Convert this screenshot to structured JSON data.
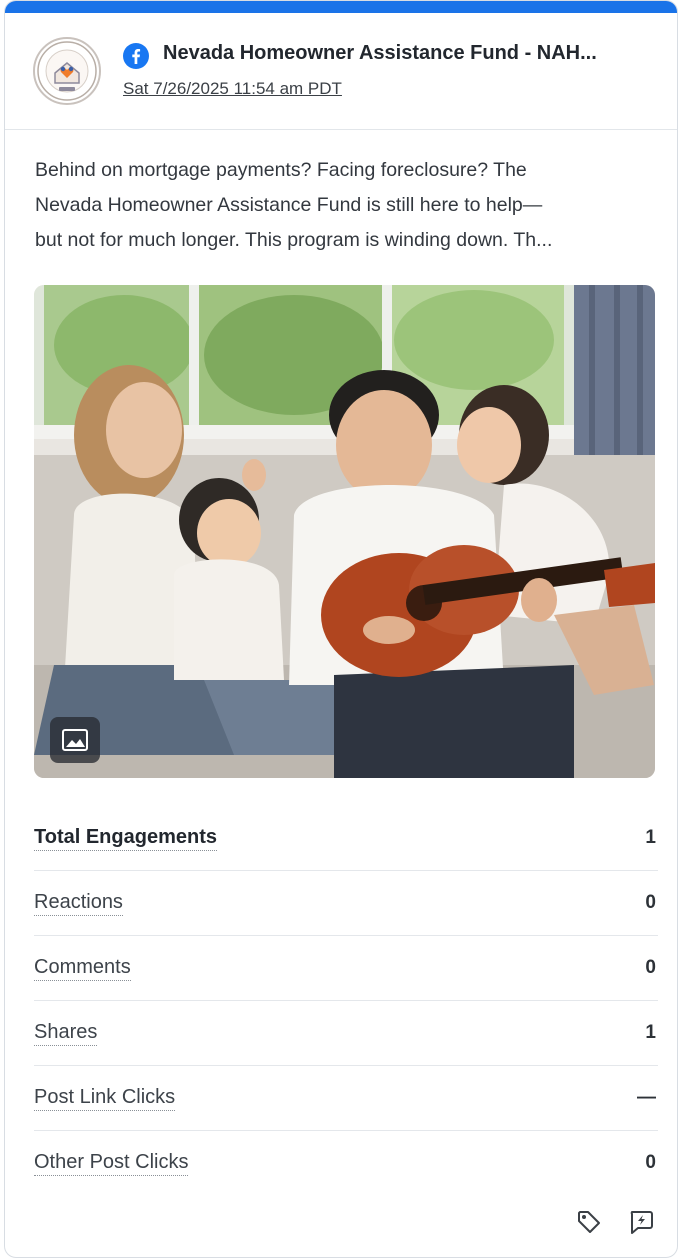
{
  "post": {
    "page_name": "Nevada Homeowner Assistance Fund - NAH...",
    "timestamp": "Sat 7/26/2025 11:54 am PDT",
    "network_icon": "facebook-icon",
    "avatar_logo_text": "HOMEOWNER ASSISTANCE FUND · NAHAC",
    "text_lines": [
      "Behind on mortgage payments? Facing foreclosure? The",
      "Nevada Homeowner Assistance Fund is still here to help—",
      "but not for much longer. This program is winding down. Th..."
    ],
    "media_badge_icon": "image-icon"
  },
  "metrics": [
    {
      "label": "Total Engagements",
      "value": "1"
    },
    {
      "label": "Reactions",
      "value": "0"
    },
    {
      "label": "Comments",
      "value": "0"
    },
    {
      "label": "Shares",
      "value": "1"
    },
    {
      "label": "Post Link Clicks",
      "value": "—"
    },
    {
      "label": "Other Post Clicks",
      "value": "0"
    }
  ],
  "footer": {
    "tag_icon": "tag-icon",
    "reply_icon": "message-bolt-icon"
  },
  "colors": {
    "accent": "#1a73e8",
    "facebook": "#1877f2"
  }
}
